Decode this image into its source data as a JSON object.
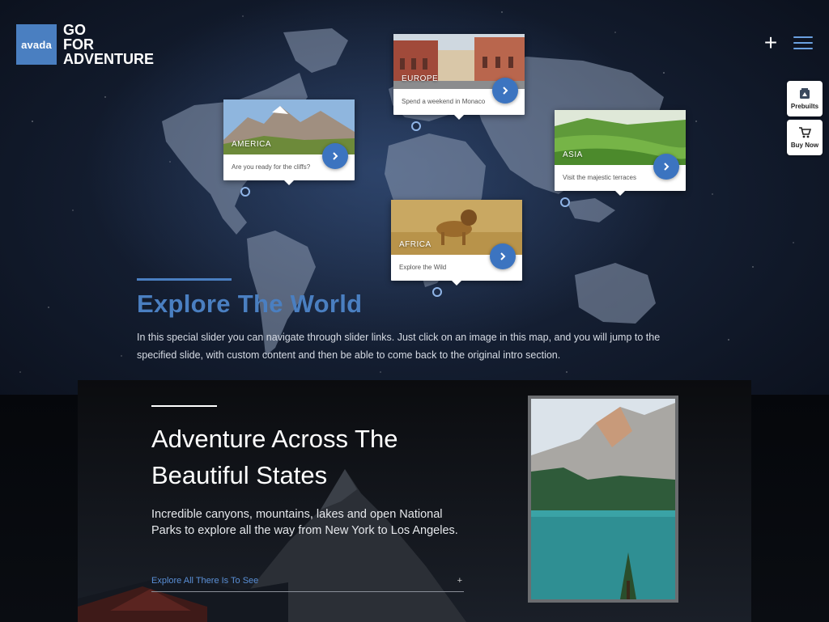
{
  "brand": {
    "logo_mark": "avada",
    "logo_line1": "GO",
    "logo_line2": "FOR",
    "logo_line3": "ADVENTURE",
    "accent": "#4a7fc1"
  },
  "header": {
    "plus_icon": "+",
    "menu_icon": "hamburger-icon"
  },
  "side_actions": [
    {
      "label": "Prebuilts",
      "icon": "prebuilts-icon"
    },
    {
      "label": "Buy Now",
      "icon": "cart-icon"
    }
  ],
  "map_cards": [
    {
      "region": "AMERICA",
      "caption": "Are you ready for the cliffs?"
    },
    {
      "region": "EUROPE",
      "caption": "Spend a weekend in Monaco"
    },
    {
      "region": "ASIA",
      "caption": "Visit the majestic terraces"
    },
    {
      "region": "AFRICA",
      "caption": "Explore the Wild"
    }
  ],
  "hero": {
    "title": "Explore The World",
    "description": "In this special slider you can navigate through slider links. Just click on an image in this map, and you will jump to the specified slide, with custom content and then be able to come back to the original intro section."
  },
  "feature": {
    "title": "Adventure Across The Beautiful States",
    "description": "Incredible canyons, mountains, lakes and open National Parks to explore all the way from New York to Los Angeles.",
    "link_label": "Explore All There Is To See",
    "link_plus": "+"
  }
}
